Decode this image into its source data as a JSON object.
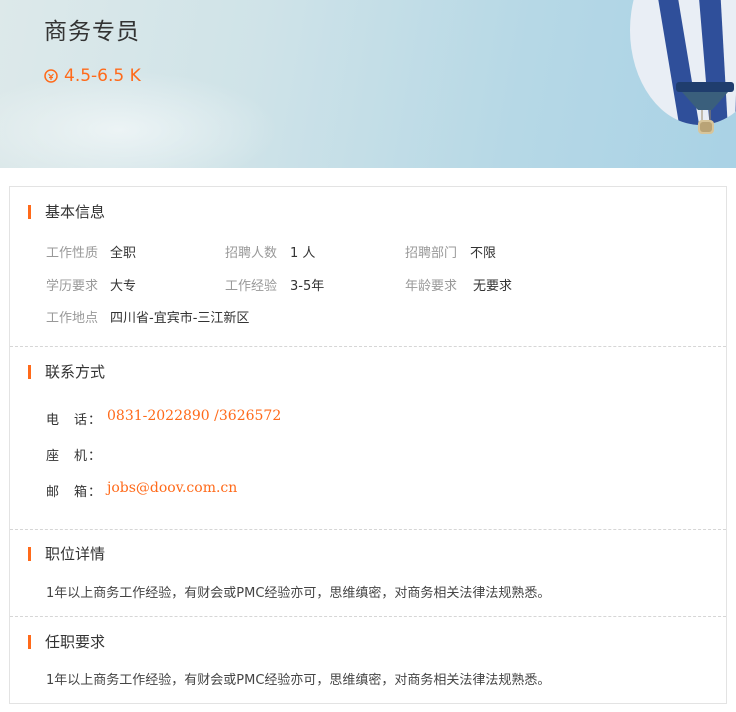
{
  "header": {
    "title": "商务专员",
    "salary": "4.5-6.5 K",
    "salary_icon": "coin-icon",
    "accent": "#ff6a1a"
  },
  "basic": {
    "title": "基本信息",
    "fields": [
      {
        "label": "工作性质",
        "value": "全职"
      },
      {
        "label": "招聘人数",
        "value": "1 人"
      },
      {
        "label": "招聘部门",
        "value": "不限"
      },
      {
        "label": "学历要求",
        "value": "大专"
      },
      {
        "label": "工作经验",
        "value": "3-5年"
      },
      {
        "label": "年龄要求",
        "value": "无要求"
      },
      {
        "label": "工作地点",
        "value": "四川省-宜宾市-三江新区"
      }
    ]
  },
  "contact": {
    "title": "联系方式",
    "phone_label": "电　话：",
    "phone_value": "0831-2022890 /3626572",
    "landline_label": "座　机：",
    "landline_value": "",
    "email_label": "邮　箱：",
    "email_value": "jobs@doov.com.cn"
  },
  "details": {
    "title": "职位详情",
    "text": "1年以上商务工作经验，有财会或PMC经验亦可，思维缜密，对商务相关法律法规熟悉。"
  },
  "requirements": {
    "title": "任职要求",
    "text": "1年以上商务工作经验，有财会或PMC经验亦可，思维缜密，对商务相关法律法规熟悉。"
  }
}
